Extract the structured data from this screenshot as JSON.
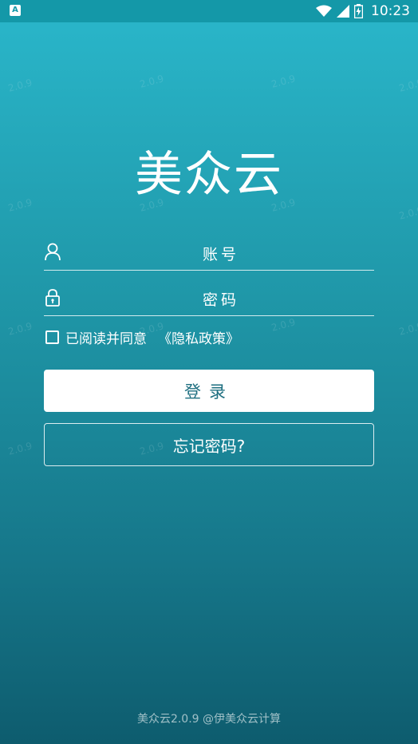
{
  "status_bar": {
    "app_badge": "A",
    "time": "10:23",
    "icons": [
      "wifi-icon",
      "signal-icon",
      "battery-charging-icon"
    ]
  },
  "watermark_text": "2.0.9",
  "app_title": "美众云",
  "login_form": {
    "account_placeholder": "账号",
    "password_placeholder": "密码",
    "agree_text": "已阅读并同意",
    "privacy_policy_link": "《隐私政策》",
    "login_button": "登录",
    "forgot_password_button": "忘记密码?"
  },
  "footer": "美众云2.0.9 @伊美众云计算",
  "colors": {
    "gradient_top": "#2ab7cb",
    "gradient_bottom": "#0e5c6e",
    "status_bar": "#1498a8",
    "login_text": "#1e6f80"
  }
}
